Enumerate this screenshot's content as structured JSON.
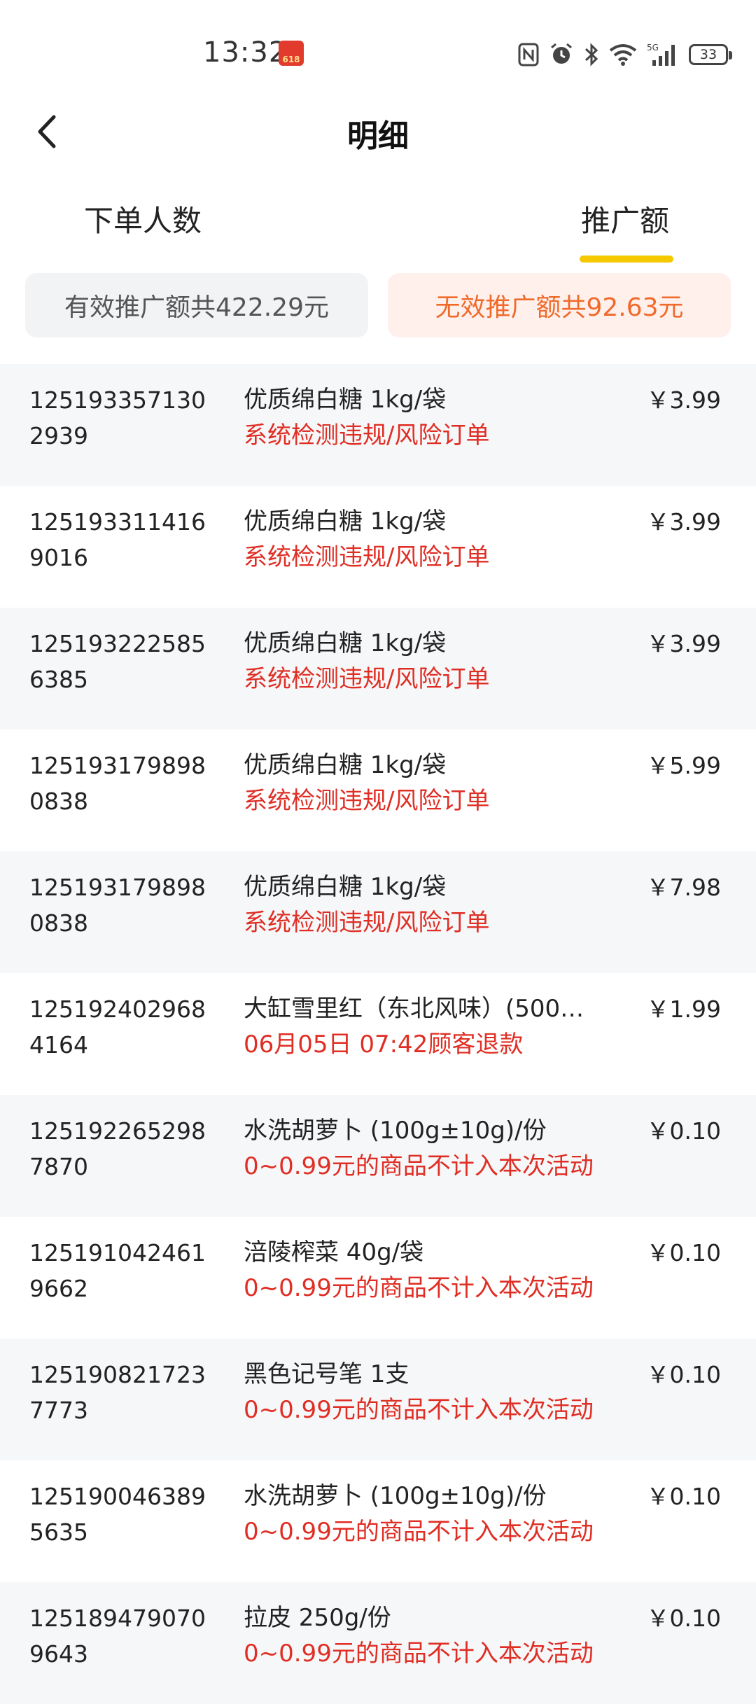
{
  "status_bar": {
    "time": "13:32",
    "badge_text": "618",
    "battery": "33",
    "network": "5G",
    "icons": [
      "nfc-icon",
      "alarm-icon",
      "bluetooth-icon",
      "wifi-icon",
      "signal-icon",
      "battery-icon"
    ]
  },
  "header": {
    "title": "明细"
  },
  "tabs": [
    {
      "label": "下单人数",
      "active": false
    },
    {
      "label": "推广额",
      "active": true
    }
  ],
  "filters": {
    "valid_label": "有效推广额共422.29元",
    "invalid_label": "无效推广额共92.63元",
    "selected": "invalid"
  },
  "orders": [
    {
      "order_no": "1251933571302939",
      "product": "优质绵白糖 1kg/袋",
      "reason": "系统检测违规/风险订单",
      "amount": "￥3.99"
    },
    {
      "order_no": "1251933114169016",
      "product": "优质绵白糖 1kg/袋",
      "reason": "系统检测违规/风险订单",
      "amount": "￥3.99"
    },
    {
      "order_no": "1251932225856385",
      "product": "优质绵白糖 1kg/袋",
      "reason": "系统检测违规/风险订单",
      "amount": "￥3.99"
    },
    {
      "order_no": "1251931798980838",
      "product": "优质绵白糖 1kg/袋",
      "reason": "系统检测违规/风险订单",
      "amount": "￥5.99"
    },
    {
      "order_no": "1251931798980838",
      "product": "优质绵白糖 1kg/袋",
      "reason": "系统检测违规/风险订单",
      "amount": "￥7.98"
    },
    {
      "order_no": "1251924029684164",
      "product": "大缸雪里红（东北风味）(500…",
      "reason": "06月05日 07:42顾客退款",
      "amount": "￥1.99"
    },
    {
      "order_no": "1251922652987870",
      "product": "水洗胡萝卜 (100g±10g)/份",
      "reason": "0~0.99元的商品不计入本次活动",
      "amount": "￥0.10"
    },
    {
      "order_no": "1251910424619662",
      "product": "涪陵榨菜 40g/袋",
      "reason": "0~0.99元的商品不计入本次活动",
      "amount": "￥0.10"
    },
    {
      "order_no": "1251908217237773",
      "product": "黑色记号笔 1支",
      "reason": "0~0.99元的商品不计入本次活动",
      "amount": "￥0.10"
    },
    {
      "order_no": "1251900463895635",
      "product": "水洗胡萝卜 (100g±10g)/份",
      "reason": "0~0.99元的商品不计入本次活动",
      "amount": "￥0.10"
    },
    {
      "order_no": "1251894790709643",
      "product": "拉皮 250g/份",
      "reason": "0~0.99元的商品不计入本次活动",
      "amount": "￥0.10"
    }
  ]
}
